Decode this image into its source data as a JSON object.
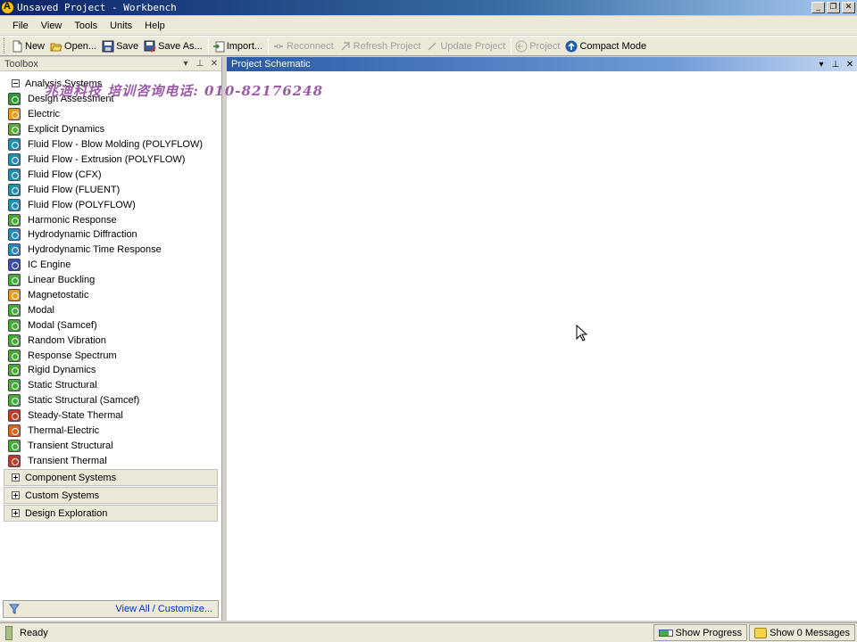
{
  "window": {
    "title": "Unsaved Project - Workbench",
    "buttons": [
      "_",
      "❐",
      "✕"
    ]
  },
  "menu": [
    "File",
    "View",
    "Tools",
    "Units",
    "Help"
  ],
  "toolbar": {
    "new": "New",
    "open": "Open...",
    "save": "Save",
    "save_as": "Save As...",
    "import": "Import...",
    "reconnect": "Reconnect",
    "refresh_project": "Refresh Project",
    "update_project": "Update Project",
    "project": "Project",
    "compact_mode": "Compact Mode"
  },
  "toolbox": {
    "title": "Toolbox",
    "controls": [
      "▾",
      "⊥",
      "✕"
    ],
    "analysis_group": "Analysis Systems",
    "analysis_systems": [
      {
        "label": "Design Assessment",
        "color": "#2e9b2e"
      },
      {
        "label": "Electric",
        "color": "#e89a1a"
      },
      {
        "label": "Explicit Dynamics",
        "color": "#5ea83a"
      },
      {
        "label": "Fluid Flow - Blow Molding (POLYFLOW)",
        "color": "#1f8fb0"
      },
      {
        "label": "Fluid Flow - Extrusion (POLYFLOW)",
        "color": "#1f8fb0"
      },
      {
        "label": "Fluid Flow (CFX)",
        "color": "#1f8fb0"
      },
      {
        "label": "Fluid Flow (FLUENT)",
        "color": "#1f8fb0"
      },
      {
        "label": "Fluid Flow (POLYFLOW)",
        "color": "#1f8fb0"
      },
      {
        "label": "Harmonic Response",
        "color": "#4aa83a"
      },
      {
        "label": "Hydrodynamic Diffraction",
        "color": "#2a85c0"
      },
      {
        "label": "Hydrodynamic Time Response",
        "color": "#2a85c0"
      },
      {
        "label": "IC Engine",
        "color": "#3a4aa8"
      },
      {
        "label": "Linear Buckling",
        "color": "#4aa83a"
      },
      {
        "label": "Magnetostatic",
        "color": "#e89a1a"
      },
      {
        "label": "Modal",
        "color": "#4aa83a"
      },
      {
        "label": "Modal (Samcef)",
        "color": "#4aa83a"
      },
      {
        "label": "Random Vibration",
        "color": "#4aa83a"
      },
      {
        "label": "Response Spectrum",
        "color": "#4aa83a"
      },
      {
        "label": "Rigid Dynamics",
        "color": "#4aa83a"
      },
      {
        "label": "Static Structural",
        "color": "#4aa83a"
      },
      {
        "label": "Static Structural (Samcef)",
        "color": "#4aa83a"
      },
      {
        "label": "Steady-State Thermal",
        "color": "#c0392b"
      },
      {
        "label": "Thermal-Electric",
        "color": "#d9641e"
      },
      {
        "label": "Transient Structural",
        "color": "#4aa83a"
      },
      {
        "label": "Transient Thermal",
        "color": "#c0392b"
      }
    ],
    "collapsed_groups": [
      "Component Systems",
      "Custom Systems",
      "Design Exploration"
    ],
    "view_all": "View All / Customize..."
  },
  "schematic": {
    "title": "Project Schematic",
    "controls": [
      "▾",
      "⊥",
      "✕"
    ]
  },
  "watermark": "兆迪科技 培训咨询电话: 010-82176248",
  "status": {
    "text": "Ready",
    "show_progress": "Show Progress",
    "show_messages": "Show 0 Messages"
  }
}
